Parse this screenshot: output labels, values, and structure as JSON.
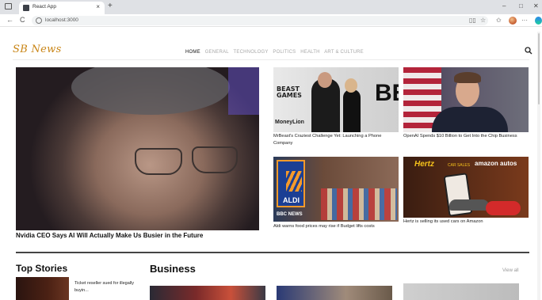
{
  "browser": {
    "tab_title": "React App",
    "tab_close": "×",
    "new_tab": "+",
    "url": "localhost:3000",
    "controls": {
      "minimize": "–",
      "maximize": "□",
      "close": "✕"
    },
    "nav": {
      "back": "←",
      "reload": "C"
    },
    "more": "···",
    "toolbar_icons": [
      "reader-view-icon",
      "favorite-star-icon",
      "favorites-icon",
      "profile-avatar",
      "more-icon",
      "edge-copilot-icon"
    ]
  },
  "site": {
    "logo": "SB News",
    "nav": [
      "HOME",
      "GENERAL",
      "TECHNOLOGY",
      "POLITICS",
      "HEALTH",
      "ART & CULTURE"
    ],
    "active_nav": "HOME",
    "search_icon": "search-icon"
  },
  "hero": {
    "headline": "Nvidia CEO Says AI Will Actually Make Us Busier in the Future"
  },
  "cards": [
    {
      "caption": "MrBeast's Craziest Challenge Yet: Launching a Phone Company",
      "image_text": [
        "BEAST",
        "GAMES"
      ],
      "image_brand": "MoneyLion",
      "image_big": "BE"
    },
    {
      "caption": "OpenAI Spends $10 Billion to Get Into the Chip Business"
    },
    {
      "caption": "Aldi warns food prices may rise if Budget lifts costs",
      "image_brand": "ALDI",
      "image_source": "BBC NEWS"
    },
    {
      "caption": "Hertz is selling its used cars on Amazon",
      "image_brand": "Hertz",
      "image_sub": "CAR SALES",
      "image_partner": "amazon autos"
    }
  ],
  "sections": {
    "top_stories": "Top Stories",
    "top_story_snippet": "Ticket reseller sued for illegally buyin...",
    "business": "Business",
    "view_all": "View all"
  },
  "colors": {
    "logo": "#c98516",
    "nav_active": "#111111",
    "nav_inactive": "#a8a8a8",
    "divider": "#444444"
  }
}
